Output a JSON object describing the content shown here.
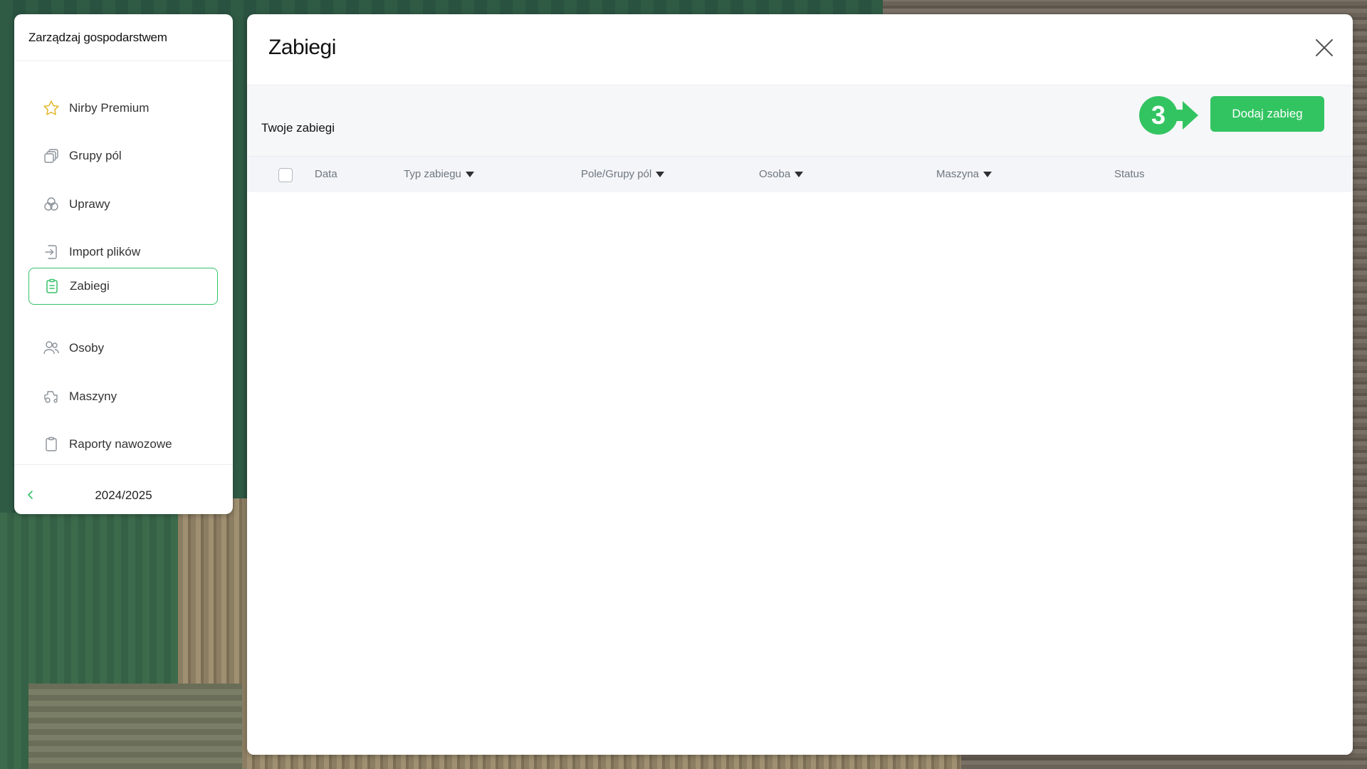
{
  "colors": {
    "accent": "#33c462",
    "active_border": "#36c26a",
    "premium_star": "#e3b72a"
  },
  "left_panel": {
    "title": "Zarządzaj gospodarstwem",
    "items": [
      {
        "label": "Nirby Premium",
        "icon": "star-icon"
      },
      {
        "label": "Grupy pól",
        "icon": "layers-icon"
      },
      {
        "label": "Uprawy",
        "icon": "crops-icon"
      },
      {
        "label": "Import plików",
        "icon": "import-icon"
      },
      {
        "label": "Zabiegi",
        "icon": "clipboard-list-icon",
        "active": true
      },
      {
        "label": "Osoby",
        "icon": "people-icon"
      },
      {
        "label": "Maszyny",
        "icon": "tractor-icon"
      },
      {
        "label": "Raporty nawozowe",
        "icon": "clipboard-icon"
      }
    ],
    "season": "2024/2025"
  },
  "main": {
    "title": "Zabiegi",
    "section_title": "Twoje zabiegi",
    "step_number": "3",
    "add_button": "Dodaj zabieg",
    "columns": [
      {
        "label": "Data",
        "sortable": false
      },
      {
        "label": "Typ zabiegu",
        "sortable": true
      },
      {
        "label": "Pole/Grupy pól",
        "sortable": true
      },
      {
        "label": "Osoba",
        "sortable": true
      },
      {
        "label": "Maszyna",
        "sortable": true
      },
      {
        "label": "Status",
        "sortable": false
      }
    ],
    "rows": []
  }
}
